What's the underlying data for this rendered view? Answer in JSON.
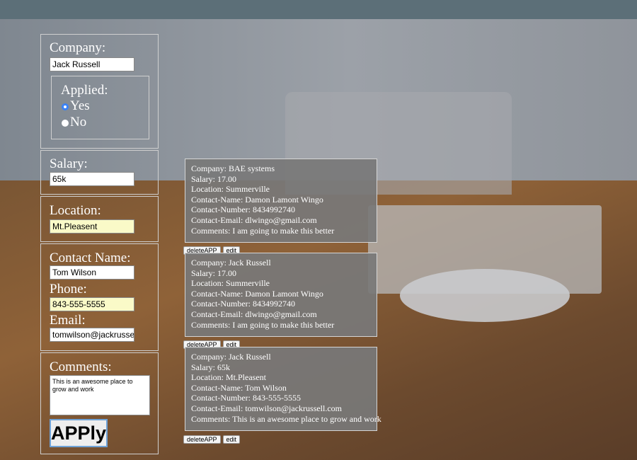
{
  "form": {
    "company_label": "Company:",
    "company_value": "Jack Russell",
    "applied_label": "Applied:",
    "applied_yes": "Yes",
    "applied_no": "No",
    "salary_label": "Salary:",
    "salary_value": "65k",
    "location_label": "Location:",
    "location_value": "Mt.Pleasent",
    "contact_name_label": "Contact Name:",
    "contact_name_value": "Tom Wilson",
    "phone_label": "Phone:",
    "phone_value": "843-555-5555",
    "email_label": "Email:",
    "email_value": "tomwilson@jackrussell.c",
    "comments_label": "Comments:",
    "comments_value": "This is an awesome place to grow and work",
    "apply_label": "APPly"
  },
  "apps": [
    {
      "company": "Company: BAE systems",
      "salary": "Salary: 17.00",
      "location": "Location: Summerville",
      "contact_name": "Contact-Name: Damon Lamont Wingo",
      "contact_number": "Contact-Number: 8434992740",
      "contact_email": "Contact-Email: dlwingo@gmail.com",
      "comments": "Comments: I am going to make this better",
      "delete_label": "deleteAPP",
      "edit_label": "edit"
    },
    {
      "company": "Company: Jack Russell",
      "salary": "Salary: 17.00",
      "location": "Location: Summerville",
      "contact_name": "Contact-Name: Damon Lamont Wingo",
      "contact_number": "Contact-Number: 8434992740",
      "contact_email": "Contact-Email: dlwingo@gmail.com",
      "comments": "Comments: I am going to make this better",
      "delete_label": "deleteAPP",
      "edit_label": "edit"
    },
    {
      "company": "Company: Jack Russell",
      "salary": "Salary: 65k",
      "location": "Location: Mt.Pleasent",
      "contact_name": "Contact-Name: Tom Wilson",
      "contact_number": "Contact-Number: 843-555-5555",
      "contact_email": "Contact-Email: tomwilson@jackrussell.com",
      "comments": "Comments: This is an awesome place to grow and work",
      "delete_label": "deleteAPP",
      "edit_label": "edit"
    }
  ]
}
